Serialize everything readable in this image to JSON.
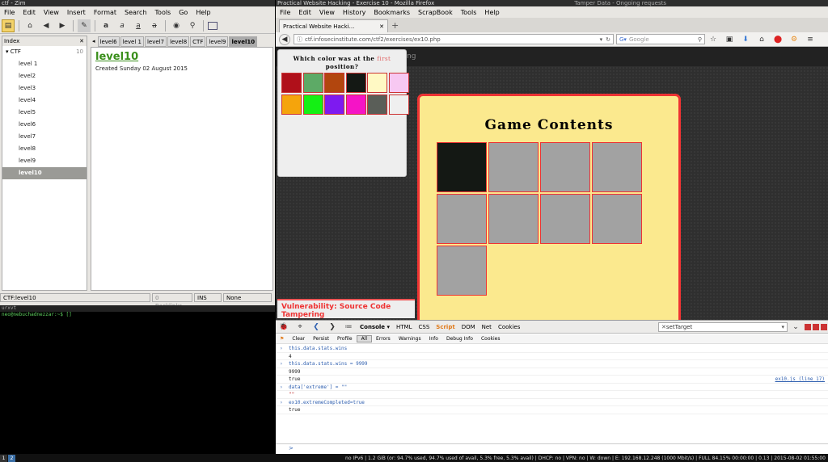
{
  "zim": {
    "title": "ctf - Zim",
    "menu": [
      "File",
      "Edit",
      "View",
      "Insert",
      "Format",
      "Search",
      "Tools",
      "Go",
      "Help"
    ],
    "index_header": "Index",
    "tree_root": "CTF",
    "tree_root_count": "10",
    "tree_items": [
      "level 1",
      "level2",
      "level3",
      "level4",
      "level5",
      "level6",
      "level7",
      "level8",
      "level9",
      "level10"
    ],
    "selected_item": "level10",
    "tabs": [
      "level6",
      "level 1",
      "level7",
      "level8",
      "CTF",
      "level9",
      "level10"
    ],
    "page_title": "level10",
    "page_created": "Created Sunday 02 August 2015",
    "status_path": "CTF:level10",
    "status_backlinks": "0 Backlinks...",
    "status_mode": "INS",
    "status_style": "None"
  },
  "terminal": {
    "title": "urxvt",
    "prompt": "neo@nebuchadnezzar:~$ []"
  },
  "firefox": {
    "title": "Practical Website Hacking - Exercise 10 - Mozilla Firefox",
    "title_right": "Tamper Data - Ongoing requests",
    "menu": [
      "File",
      "Edit",
      "View",
      "History",
      "Bookmarks",
      "ScrapBook",
      "Tools",
      "Help"
    ],
    "tab_label": "Practical Website Hacki...",
    "url": "ctf.infosecinstitute.com/ctf2/exercises/ex10.php",
    "search_placeholder": "Google",
    "page_strip_text": "ng"
  },
  "exercise": {
    "question_prefix": "Which color was at the ",
    "question_first": "first",
    "question_suffix": "position?",
    "swatch_colors": [
      "#b0101a",
      "#5daa66",
      "#b2460e",
      "#141814",
      "#fff9c4",
      "#f7c8f2",
      "#f5a40c",
      "#14f014",
      "#7e1af0",
      "#f514c6",
      "#5a5e58",
      "#efefef"
    ],
    "game_title": "Game Contents",
    "grid_colors": [
      "#141814",
      "#a2a2a2",
      "#a2a2a2",
      "#a2a2a2",
      "#a2a2a2",
      "#a2a2a2",
      "#a2a2a2",
      "#a2a2a2",
      "#a2a2a2"
    ],
    "vuln_label": "Vulnerability: Source Code Tampering"
  },
  "devtools": {
    "tabs": [
      "Console",
      "HTML",
      "CSS",
      "Script",
      "DOM",
      "Net",
      "Cookies"
    ],
    "search_value": "setTarget",
    "subtabs": [
      "Clear",
      "Persist",
      "Profile",
      "All",
      "Errors",
      "Warnings",
      "Info",
      "Debug Info",
      "Cookies"
    ],
    "console_lines": [
      {
        "text": "this.data.stats.wins",
        "kind": "cmd"
      },
      {
        "text": "4",
        "kind": "out"
      },
      {
        "text": "this.data.stats.wins = 9999",
        "kind": "cmd"
      },
      {
        "text": "9999",
        "kind": "out"
      },
      {
        "text": "true",
        "kind": "out",
        "src": "ex10.js (line 17)"
      },
      {
        "text": "data['extreme'] = \"\"",
        "kind": "cmd"
      },
      {
        "text": "\"\"",
        "kind": "str"
      },
      {
        "text": "ex10.extremeCompleted=true",
        "kind": "cmd"
      },
      {
        "text": "true",
        "kind": "out"
      }
    ],
    "input_prompt": ">"
  },
  "panel": {
    "workspaces": [
      "1",
      "2"
    ],
    "status": "no IPv6 | 1.2 GiB (or: 94.7% used, 94.7% used of avail, 5.3% free, 5.3% avail) | DHCP: no | VPN: no | W: down | E: 192.168.12.248 (1000 Mbit/s) | FULL 84.15% 00:00:00 | 0.13 | 2015-08-02 01:55:00"
  }
}
